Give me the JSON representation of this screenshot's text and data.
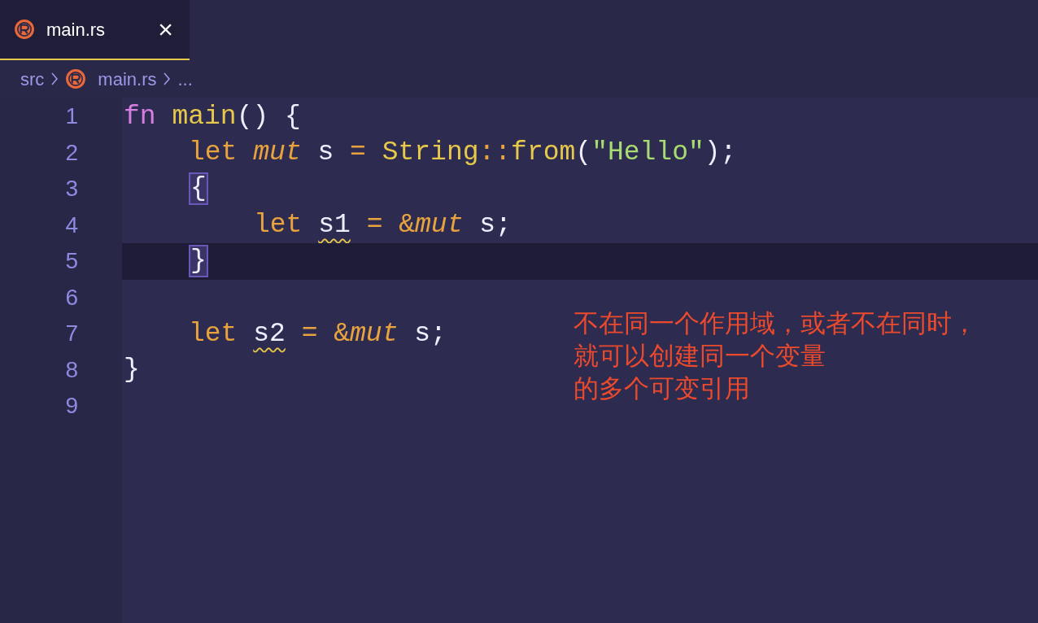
{
  "tabs": [
    {
      "label": "main.rs",
      "selected": true,
      "close": "×"
    }
  ],
  "breadcrumb": [
    {
      "label": "src",
      "kind": "folder"
    },
    {
      "label": "main.rs",
      "kind": "file"
    },
    {
      "label": "...",
      "kind": "more"
    }
  ],
  "code_lines": [
    {
      "number": "1",
      "current": false,
      "tokens": [
        {
          "text": "fn ",
          "kind": "keyword"
        },
        {
          "text": "main",
          "kind": "function"
        },
        {
          "text": "() {",
          "kind": "plain"
        }
      ],
      "children": [
        {
          "number": "2",
          "current": false,
          "tokens": [
            {
              "text": "let ",
              "kind": "let"
            },
            {
              "text": "mut",
              "kind": "modifier"
            },
            {
              "text": " s ",
              "kind": "plain"
            },
            {
              "text": "= ",
              "kind": "operator"
            },
            {
              "text": "String",
              "kind": "type"
            },
            {
              "text": "::",
              "kind": "operator"
            },
            {
              "text": "from",
              "kind": "function"
            },
            {
              "text": "(",
              "kind": "plain"
            },
            {
              "text": "\"Hello\"",
              "kind": "string"
            },
            {
              "text": ");",
              "kind": "plain"
            }
          ]
        },
        {
          "number": "3",
          "current": false,
          "tokens": [
            {
              "text": "{",
              "kind": "plain",
              "matched": true
            }
          ],
          "children": [
            {
              "number": "4",
              "current": false,
              "tokens": [
                {
                  "text": "let ",
                  "kind": "let"
                },
                {
                  "text": "s1",
                  "kind": "plain",
                  "warning": true
                },
                {
                  "text": " = &",
                  "kind": "operator"
                },
                {
                  "text": "mut",
                  "kind": "modifier"
                },
                {
                  "text": " s;",
                  "kind": "plain"
                }
              ]
            }
          ]
        },
        {
          "number": "5",
          "current": true,
          "tokens": [
            {
              "text": "}",
              "kind": "plain",
              "matched": true
            }
          ]
        },
        {
          "number": "6",
          "current": false
        },
        {
          "number": "7",
          "current": false,
          "tokens": [
            {
              "text": "let ",
              "kind": "let"
            },
            {
              "text": "s2",
              "kind": "plain",
              "warning": true
            },
            {
              "text": " = &",
              "kind": "operator"
            },
            {
              "text": "mut",
              "kind": "modifier"
            },
            {
              "text": " s;",
              "kind": "plain"
            }
          ]
        }
      ]
    },
    {
      "number": "8",
      "current": false,
      "tokens": [
        {
          "text": "}",
          "kind": "plain"
        }
      ]
    },
    {
      "number": "9",
      "current": false
    }
  ],
  "annotation": [
    "不在同一个作用域，或者不在同时，",
    "就可以创建同一个变量",
    "的多个可变引用"
  ]
}
